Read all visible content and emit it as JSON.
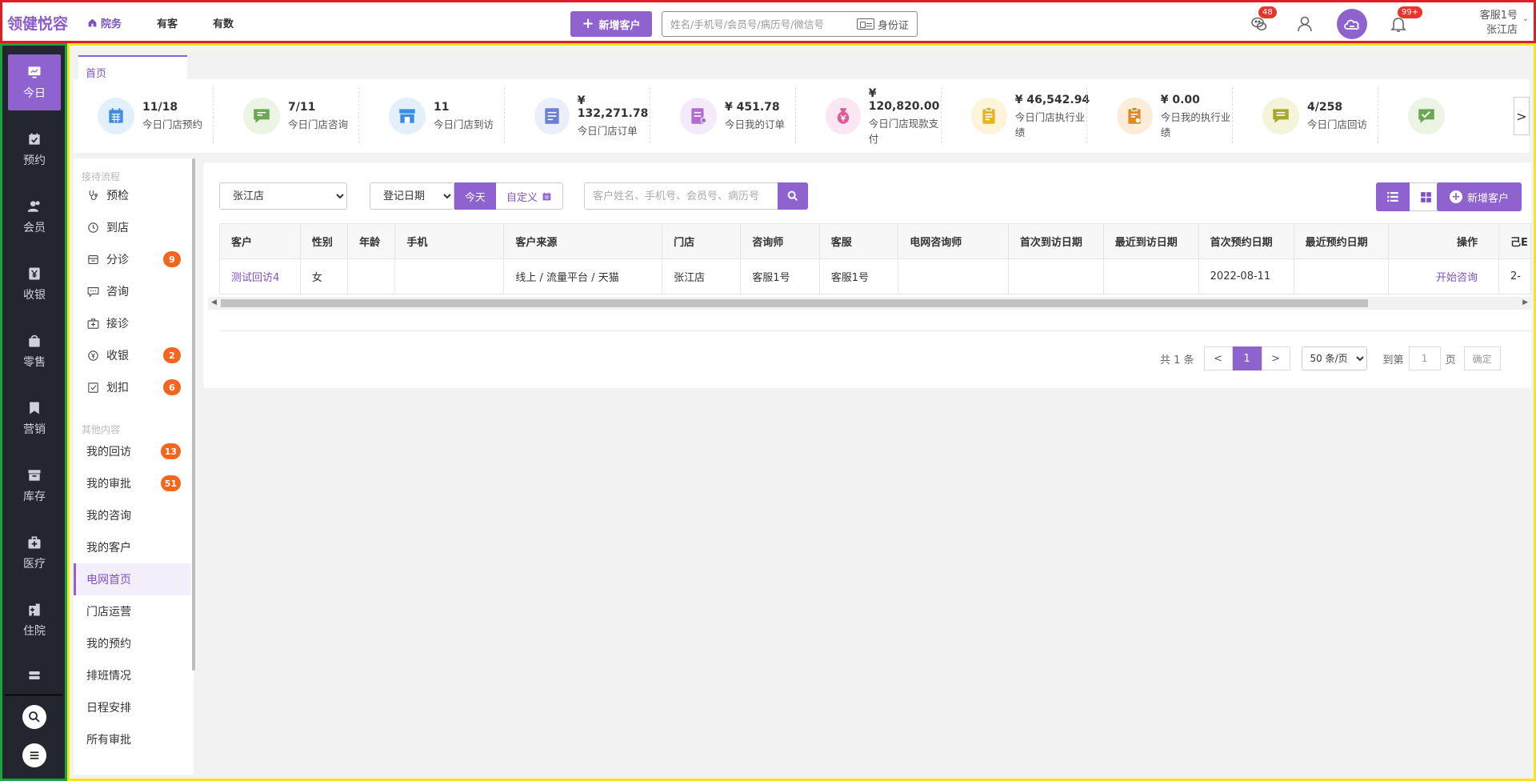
{
  "header": {
    "logo": "领健悦容",
    "nav": [
      {
        "label": "院务",
        "active": true
      },
      {
        "label": "有客",
        "active": false
      },
      {
        "label": "有数",
        "active": false
      }
    ],
    "add_customer_label": "新增客户",
    "search_placeholder": "姓名/手机号/会员号/病历号/微信号",
    "idcard_label": "身份证",
    "badges": {
      "chat": "48",
      "notify": "99+"
    },
    "user_name": "客服1号",
    "user_store": "张江店",
    "accent_color": "#8e63cf"
  },
  "sidebar": {
    "items": [
      {
        "label": "今日",
        "icon": "monitor-icon",
        "active": true
      },
      {
        "label": "预约",
        "icon": "calendar-check-icon"
      },
      {
        "label": "会员",
        "icon": "users-icon"
      },
      {
        "label": "收银",
        "icon": "yen-icon"
      },
      {
        "label": "零售",
        "icon": "shopping-bag-icon"
      },
      {
        "label": "营销",
        "icon": "bookmark-icon"
      },
      {
        "label": "库存",
        "icon": "archive-icon"
      },
      {
        "label": "医疗",
        "icon": "medical-kit-icon"
      },
      {
        "label": "住院",
        "icon": "hospital-icon"
      }
    ]
  },
  "tabs": [
    {
      "label": "首页",
      "active": true
    }
  ],
  "stats": [
    {
      "value": "11/18",
      "label": "今日门店预约",
      "icon": "calendar-grid-icon",
      "color": "#3b8de0",
      "bg": "#e3effb"
    },
    {
      "value": "7/11",
      "label": "今日门店咨询",
      "icon": "chat-plus-icon",
      "color": "#6aa84f",
      "bg": "#ebf4e5"
    },
    {
      "value": "11",
      "label": "今日门店到访",
      "icon": "store-icon",
      "color": "#3b8de0",
      "bg": "#e3effb"
    },
    {
      "value": "¥ 132,271.78",
      "label": "今日门店订单",
      "icon": "order-doc-icon",
      "color": "#6a7fd6",
      "bg": "#ebeefb"
    },
    {
      "value": "¥ 451.78",
      "label": "今日我的订单",
      "icon": "my-order-icon",
      "color": "#b06ccf",
      "bg": "#f4eaf9"
    },
    {
      "value": "¥ 120,820.00",
      "label": "今日门店现款支付",
      "icon": "money-bag-icon",
      "color": "#e05a9a",
      "bg": "#fbe7f1"
    },
    {
      "value": "¥ 46,542.94",
      "label": "今日门店执行业绩",
      "icon": "clipboard-icon",
      "color": "#e6b422",
      "bg": "#fdf4da"
    },
    {
      "value": "¥ 0.00",
      "label": "今日我的执行业绩",
      "icon": "clipboard-user-icon",
      "color": "#e08a22",
      "bg": "#fcedd9"
    },
    {
      "value": "4/258",
      "label": "今日门店回访",
      "icon": "chat-lines-icon",
      "color": "#a6a82a",
      "bg": "#f4f4d9"
    },
    {
      "value": "",
      "label": "",
      "icon": "chat-check-icon",
      "color": "#6aa84f",
      "bg": "#ebf4e5"
    }
  ],
  "stats_next": ">",
  "submenu": {
    "section1": "接待流程",
    "section1_items": [
      {
        "label": "预检",
        "icon": "stethoscope-icon",
        "count": ""
      },
      {
        "label": "到店",
        "icon": "history-icon",
        "count": ""
      },
      {
        "label": "分诊",
        "icon": "triage-icon",
        "count": "9"
      },
      {
        "label": "咨询",
        "icon": "chat-dots-icon",
        "count": ""
      },
      {
        "label": "接诊",
        "icon": "medical-box-icon",
        "count": ""
      },
      {
        "label": "收银",
        "icon": "coin-icon",
        "count": "2"
      },
      {
        "label": "划扣",
        "icon": "check-square-icon",
        "count": "6"
      }
    ],
    "section2": "其他内容",
    "section2_items": [
      {
        "label": "我的回访",
        "count": "13"
      },
      {
        "label": "我的审批",
        "count": "51"
      },
      {
        "label": "我的咨询",
        "count": ""
      },
      {
        "label": "我的客户",
        "count": ""
      },
      {
        "label": "电网首页",
        "count": "",
        "active": true
      },
      {
        "label": "门店运营",
        "count": ""
      },
      {
        "label": "我的预约",
        "count": ""
      },
      {
        "label": "排班情况",
        "count": ""
      },
      {
        "label": "日程安排",
        "count": ""
      },
      {
        "label": "所有审批",
        "count": ""
      }
    ]
  },
  "filters": {
    "store": "张江店",
    "date_type": "登记日期",
    "today_label": "今天",
    "custom_label": "自定义",
    "search_placeholder": "客户姓名、手机号、会员号、病历号",
    "add_customer_label": "新增客户"
  },
  "table": {
    "columns": [
      "客户",
      "性别",
      "年龄",
      "手机",
      "客户来源",
      "门店",
      "咨询师",
      "客服",
      "电网咨询师",
      "首次到访日期",
      "最近到访日期",
      "首次预约日期",
      "最近预约日期",
      "操作",
      "己E"
    ],
    "rows": [
      {
        "customer": "测试回访4",
        "gender": "女",
        "age": "",
        "phone": "",
        "source": "线上 / 流量平台 / 天猫",
        "store": "张江店",
        "consultant": "客服1号",
        "service": "客服1号",
        "net_consultant": "",
        "first_visit": "",
        "last_visit": "",
        "first_appt": "2022-08-11",
        "last_appt": "",
        "action": "开始咨询",
        "extra": "2-"
      }
    ]
  },
  "pagination": {
    "total": "共 1 条",
    "prev": "<",
    "current": "1",
    "next": ">",
    "page_size": "50 条/页",
    "goto_label": "到第",
    "goto_value": "1",
    "page_unit": "页",
    "confirm": "确定"
  }
}
